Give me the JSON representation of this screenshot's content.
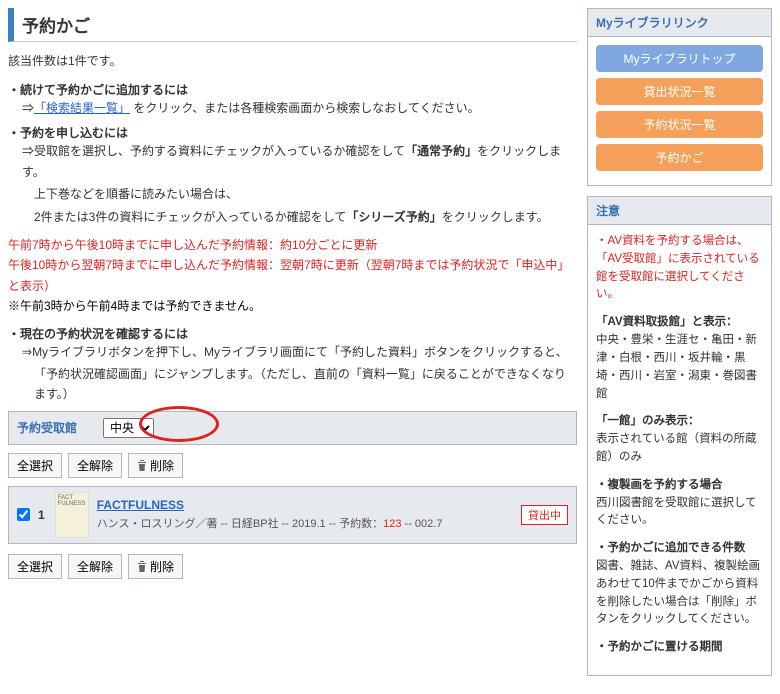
{
  "pageTitle": "予約かご",
  "countLine": "該当件数は1件です。",
  "sec1": {
    "head": "・続けて予約かごに追加するには",
    "linkText": "「検索結果一覧」",
    "tail": " をクリック、または各種検索画面から検索しなおしてください。"
  },
  "sec2": {
    "head": "・予約を申し込むには",
    "l1a": "受取館を選択し、予約する資料にチェックが入っているか確認をして",
    "l1b": "「通常予約」",
    "l1c": "をクリックします。",
    "l2": "上下巻などを順番に読みたい場合は、",
    "l3a": "2件または3件の資料にチェックが入っているか確認をして",
    "l3b": "「シリーズ予約」",
    "l3c": "をクリックします。"
  },
  "red": {
    "l1": "午前7時から午後10時までに申し込んだ予約情報：約10分ごとに更新",
    "l2": "午後10時から翌朝7時までに申し込んだ予約情報：翌朝7時に更新（翌朝7時までは予約状況で「申込中」と表示）",
    "l3": "※午前3時から午前4時までは予約できません。"
  },
  "sec3": {
    "head": "・現在の予約状況を確認するには",
    "l1": "Myライブラリボタンを押下し、Myライブラリ画面にて「予約した資料」ボタンをクリックすると、",
    "l2": "「予約状況確認画面」にジャンプします。（ただし、直前の「資料一覧」に戻ることができなくなります。）"
  },
  "pickup": {
    "label": "予約受取館",
    "value": "中央"
  },
  "buttons": {
    "selectAll": "全選択",
    "clearAll": "全解除",
    "delete": "削除"
  },
  "item": {
    "num": "1",
    "title": "FACTFULNESS",
    "thumb": "FACT FULNESS",
    "metaA": "ハンス・ロスリング／著 -- 日経BP社 -- 2019.1 -- 予約数：",
    "metaRed": "123",
    "metaB": " -- 002.7",
    "badge": "貸出中"
  },
  "side": {
    "linksTitle": "Myライブラリリンク",
    "links": [
      "Myライブラリトップ",
      "貸出状況一覧",
      "予約状況一覧",
      "予約かご"
    ],
    "noticeTitle": "注意",
    "n1": "・AV資料を予約する場合は、「AV受取館」に表示されている館を受取館に選択してください。",
    "n2h": "「AV資料取扱館」と表示：",
    "n2b": "中央・豊栄・生涯セ・亀田・新津・白根・西川・坂井輪・黒埼・西川・岩室・潟東・巻図書館",
    "n3h": "「一館」のみ表示：",
    "n3b": "表示されている館（資料の所蔵館）のみ",
    "n4h": "・複製画を予約する場合",
    "n4b": "西川図書館を受取館に選択してください。",
    "n5h": "・予約かごに追加できる件数",
    "n5b": "図書、雑誌、AV資料、複製絵画あわせて10件までかごから資料を削除したい場合は「削除」ボタンをクリックしてください。",
    "n6h": "・予約かごに置ける期間"
  }
}
